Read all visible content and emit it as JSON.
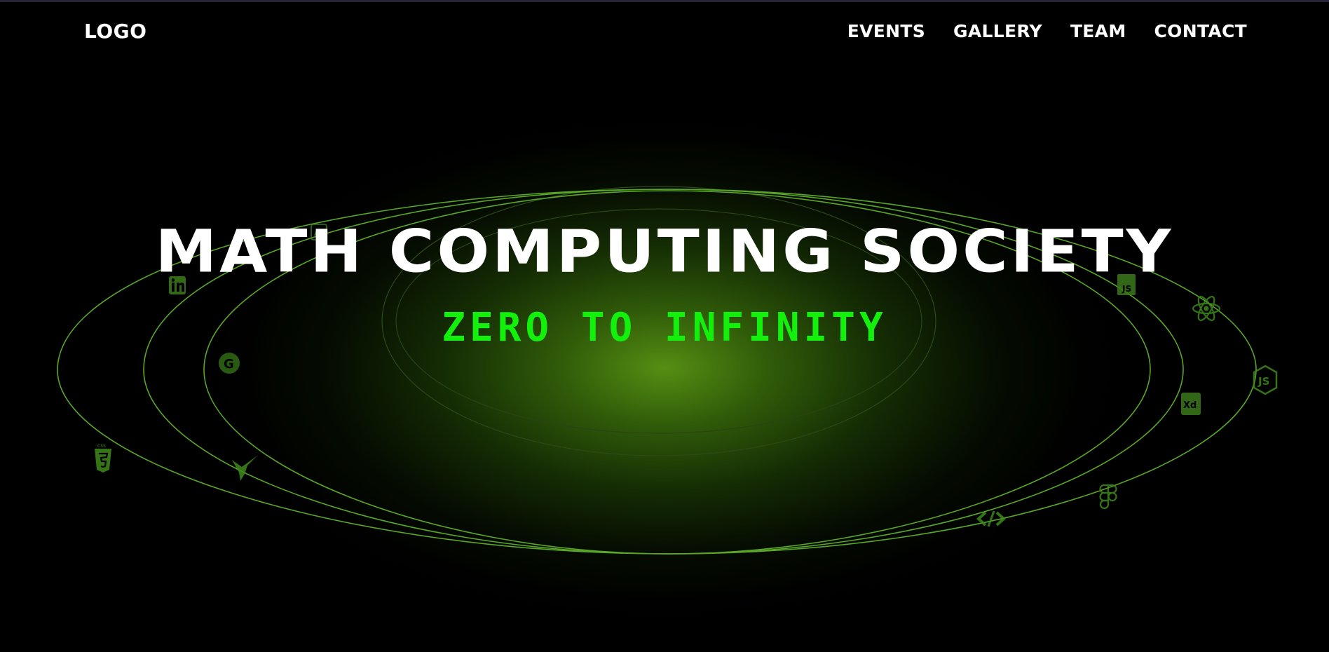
{
  "nav": {
    "logo": "LOGO",
    "links": [
      "EVENTS",
      "GALLERY",
      "TEAM",
      "CONTACT"
    ]
  },
  "hero": {
    "title": "MATH COMPUTING SOCIETY",
    "subtitle": "ZERO TO INFINITY"
  },
  "orbit_icons": [
    "adobe-illustrator-icon",
    "linkedin-icon",
    "google-icon",
    "css3-icon",
    "hummingbird-icon",
    "javascript-icon",
    "react-icon",
    "nodejs-icon",
    "adobe-xd-icon",
    "figma-icon",
    "code-brackets-icon"
  ],
  "colors": {
    "background": "#000000",
    "accent_green": "#12f00c",
    "orbit_green": "#5aa628",
    "glow_green": "#5a9614"
  }
}
